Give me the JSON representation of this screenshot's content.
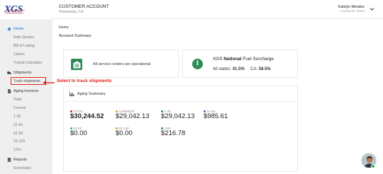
{
  "logo_text": "XGS",
  "header": {
    "title": "CUSTOMER ACCOUNT",
    "subtitle": "Pleasanton, CA",
    "user_name": "Katelyn Mendez",
    "user_role": "Customer Team"
  },
  "sidebar": {
    "home": {
      "label": "Home",
      "items": [
        "Rate Quotes",
        "Bill of Lading",
        "Claims",
        "Transit Calculator"
      ]
    },
    "shipments": {
      "label": "Shipments",
      "items": [
        "Track shipments"
      ]
    },
    "aging": {
      "label": "Aging Invoices",
      "items": [
        "Total",
        "Current",
        "1-30",
        "31-60",
        "61-90",
        "91-120",
        "120+"
      ]
    },
    "reports": {
      "label": "Reports",
      "items": [
        "Scheduled"
      ]
    }
  },
  "main": {
    "breadcrumb": "Home",
    "title": "Account Summary",
    "status_text": "All service centers are operational",
    "fuel": {
      "title_prefix": "XGS",
      "title_bold": "National",
      "title_suffix": "Fuel Surcharge",
      "all_label": "All states:",
      "all_value": "41.5%",
      "ca_label": "CA:",
      "ca_value": "58.5%"
    },
    "aging": {
      "title": "Aging Summary",
      "metrics": [
        {
          "label": "TOTAL",
          "value": "$30,244.52",
          "color": "#e2231a"
        },
        {
          "label": "CURRENT",
          "value": "$29,042.13",
          "color": "#e8a317"
        },
        {
          "label": "1-30",
          "value": "$29,042.13",
          "color": "#2e8b57"
        },
        {
          "label": "31-60",
          "value": "$985.61",
          "color": "#8e44ad"
        },
        {
          "label": "61-90",
          "value": "$0.00",
          "color": "#3aa0c8"
        },
        {
          "label": "91-120",
          "value": "$0.00",
          "color": "#e8a317"
        },
        {
          "label": "120+",
          "value": "$216.78",
          "color": "#2e8b57"
        }
      ]
    }
  },
  "annotation": "Select to track shipments",
  "colors": {
    "accent": "#1e74c9",
    "highlight": "#e2231a",
    "success": "#2e8b57"
  }
}
